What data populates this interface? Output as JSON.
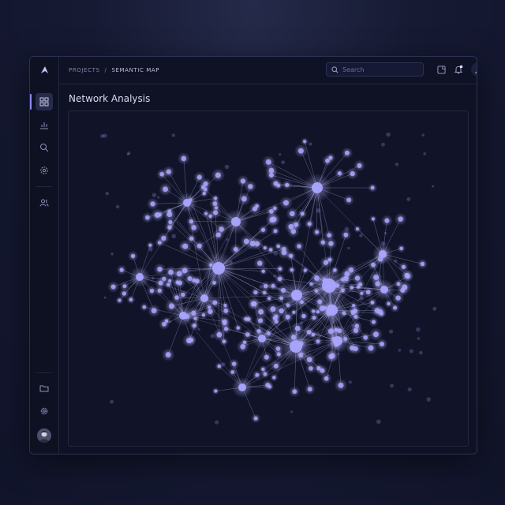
{
  "breadcrumb": {
    "root": "PROJECTS",
    "separator": "/",
    "current": "SEMANTIC MAP"
  },
  "search": {
    "placeholder": "Search",
    "value": ""
  },
  "page": {
    "title": "Network Analysis"
  },
  "sidebar": {
    "items": [
      {
        "icon": "grid-icon",
        "active": true
      },
      {
        "icon": "bar-chart-icon",
        "active": false
      },
      {
        "icon": "search-icon",
        "active": false
      },
      {
        "icon": "settings-target-icon",
        "active": false
      },
      {
        "icon": "users-icon",
        "active": false
      }
    ],
    "bottom": [
      {
        "icon": "folder-icon"
      },
      {
        "icon": "gear-icon"
      }
    ]
  },
  "topbar": {
    "icons": [
      "panel-icon",
      "bell-icon",
      "user-icon",
      "chevron-down-icon"
    ],
    "notification_dot": true
  },
  "colors": {
    "accent": "#8c88ff",
    "node": "#a9a5ff",
    "edge": "#c8c6ff",
    "background": "#111429"
  }
}
